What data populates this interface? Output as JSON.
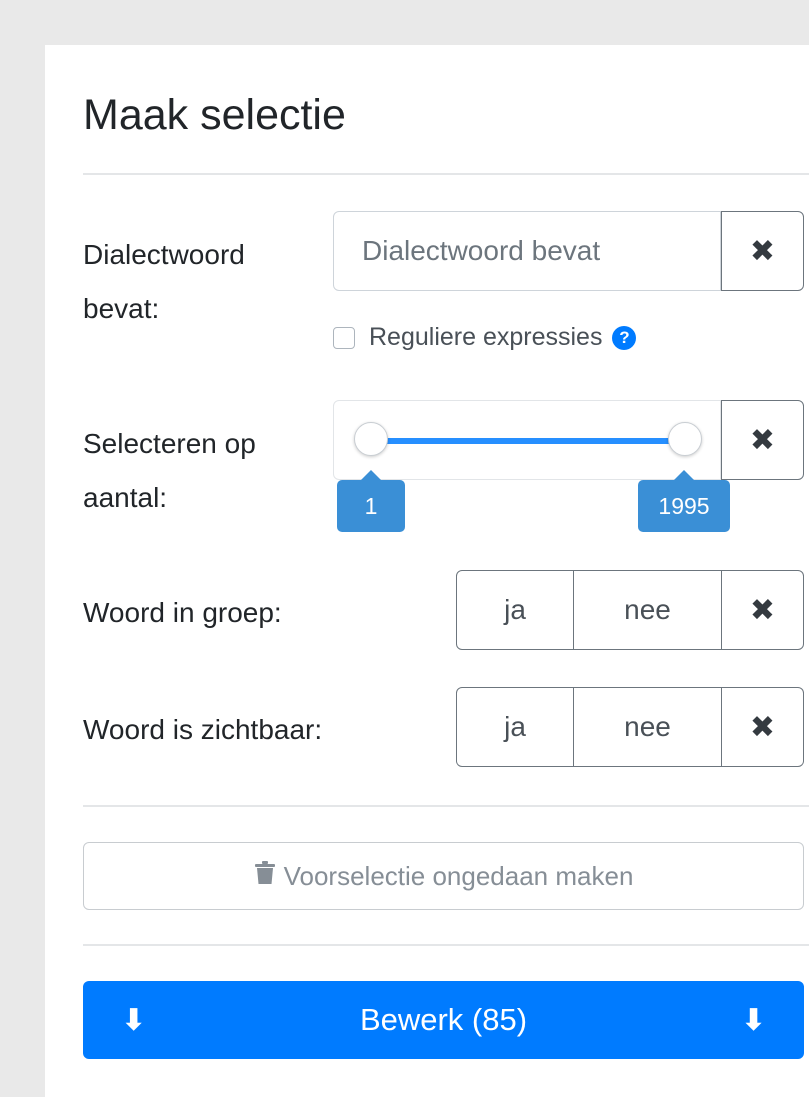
{
  "panel": {
    "title": "Maak selectie"
  },
  "dialectwoord": {
    "label": "Dialectwoord bevat:",
    "placeholder": "Dialectwoord bevat",
    "value": "",
    "clear": "✖",
    "regex_label": "Reguliere expressies",
    "regex_checked": false,
    "help": "?"
  },
  "aantal": {
    "label": "Selecteren op aantal:",
    "min": "1",
    "max": "1995",
    "clear": "✖"
  },
  "in_groep": {
    "label": "Woord in groep:",
    "ja": "ja",
    "nee": "nee",
    "clear": "✖"
  },
  "zichtbaar": {
    "label": "Woord is zichtbaar:",
    "ja": "ja",
    "nee": "nee",
    "clear": "✖"
  },
  "undo": {
    "label": "Voorselectie ongedaan maken",
    "icon": "trash-icon"
  },
  "bewerk": {
    "label": "Bewerk (85)",
    "icon": "arrow-down-icon"
  },
  "colors": {
    "primary": "#007bff",
    "tooltip": "#3a8fd6",
    "background": "#e9e9e9"
  }
}
